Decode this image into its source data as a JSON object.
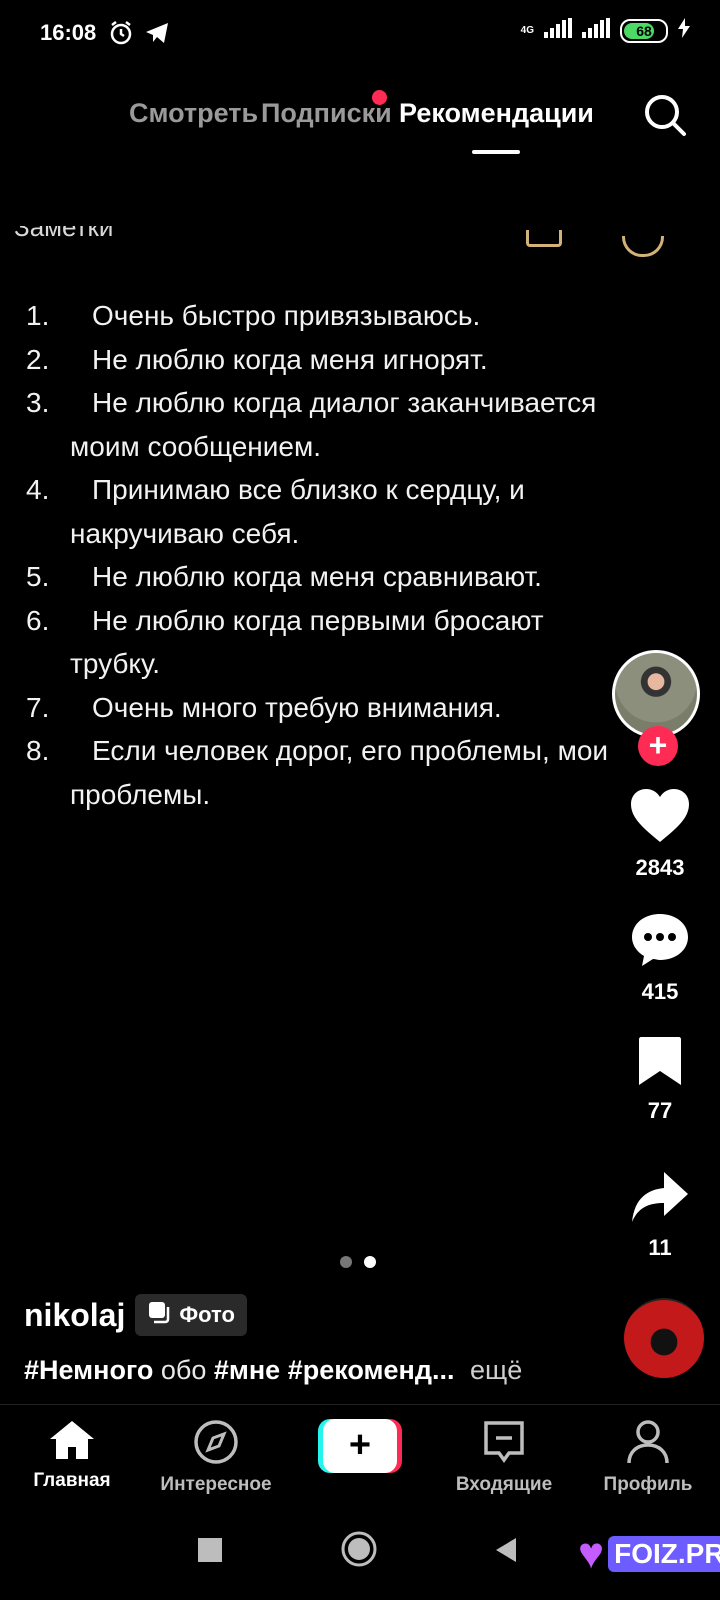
{
  "status_bar": {
    "time": "16:08",
    "network": "4G",
    "battery_level": "68",
    "icons": [
      "alarm-icon",
      "telegram-icon",
      "signal-icon",
      "charging-icon"
    ]
  },
  "top_tabs": {
    "tabs": [
      "Смотреть",
      "Подписки",
      "Рекомендации"
    ],
    "active": "Рекомендации",
    "has_notification_on": "Подписки"
  },
  "note_header_cut": "Заметки",
  "notes": [
    {
      "num": "1.",
      "text": "Очень быстро привязываюсь."
    },
    {
      "num": "2.",
      "text": "Не люблю когда меня игнорят."
    },
    {
      "num": "3.",
      "text": "Не люблю когда диалог заканчивается моим сообщением."
    },
    {
      "num": "4.",
      "text": "Принимаю все близко к сердцу, и накручиваю себя."
    },
    {
      "num": "5.",
      "text": "Не люблю когда меня сравнивают."
    },
    {
      "num": "6.",
      "text": "Не люблю когда первыми бросают трубку."
    },
    {
      "num": "7.",
      "text": "Очень много требую внимания."
    },
    {
      "num": "8.",
      "text": "Если человек дорог, его проблемы, мои проблемы."
    }
  ],
  "actions": {
    "likes": "2843",
    "comments": "415",
    "saves": "77",
    "shares": "11"
  },
  "post": {
    "author": "nikolaj",
    "badge": "Фото",
    "caption_tag1": "#Немного",
    "caption_word": "обо",
    "caption_tag2": "#мне",
    "caption_tag3": "#рекоменд...",
    "more": "ещё",
    "carousel_pages": 2,
    "carousel_active": 2
  },
  "bottom_nav": {
    "home": "Главная",
    "discover": "Интересное",
    "create": "+",
    "inbox": "Входящие",
    "profile": "Профиль"
  },
  "watermark": "FOIZ.PRO",
  "colors": {
    "accent": "#fe2c55",
    "cyan": "#25f4ee",
    "battery": "#4cd964"
  }
}
